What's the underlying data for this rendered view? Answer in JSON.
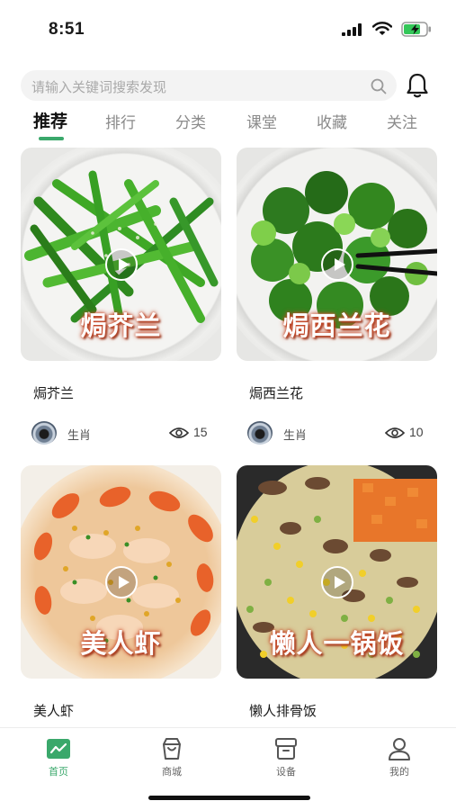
{
  "status_bar": {
    "time": "8:51"
  },
  "search": {
    "placeholder": "请输入关键词搜索发现"
  },
  "tabs": [
    {
      "label": "推荐",
      "active": true
    },
    {
      "label": "排行"
    },
    {
      "label": "分类"
    },
    {
      "label": "课堂"
    },
    {
      "label": "收藏"
    },
    {
      "label": "关注"
    }
  ],
  "recipes": [
    {
      "overlay": "焗芥兰",
      "title": "焗芥兰",
      "author": "生肖",
      "views": "15"
    },
    {
      "overlay": "焗西兰花",
      "title": "焗西兰花",
      "author": "生肖",
      "views": "10"
    },
    {
      "overlay": "美人虾",
      "title": "美人虾"
    },
    {
      "overlay": "懒人一锅饭",
      "title": "懒人排骨饭"
    }
  ],
  "bottom_nav": [
    {
      "label": "首页",
      "icon": "home-chart-icon",
      "active": true
    },
    {
      "label": "商城",
      "icon": "shopping-bag-icon"
    },
    {
      "label": "设备",
      "icon": "device-box-icon"
    },
    {
      "label": "我的",
      "icon": "person-icon"
    }
  ],
  "colors": {
    "accent": "#3aa86b",
    "tab_inactive": "#8a8a8a",
    "search_bg": "#f3f3f3"
  }
}
